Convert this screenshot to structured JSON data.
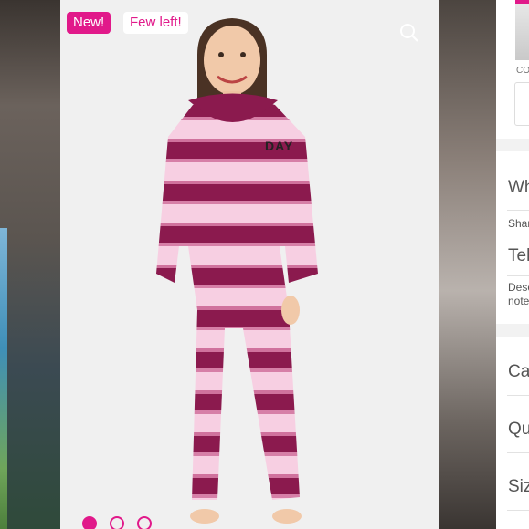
{
  "badges": {
    "new": "New!",
    "few_left": "Few left!"
  },
  "product": {
    "graphic_text": "DAY",
    "colors": {
      "accent": "#e1198a",
      "tie_dye_dark": "#8b1a4e",
      "tie_dye_light": "#f5c6dd"
    }
  },
  "carousel": {
    "dot_count": 3,
    "active_index": 0
  },
  "side_panel": {
    "thumb_label": "CO",
    "heading_1": "Wh",
    "share_label": "Shar",
    "heading_2": "Tel",
    "desc_line_1": "Desc",
    "desc_line_2": "note",
    "field_1": "Ca",
    "field_2": "Qu",
    "field_3": "Siz"
  }
}
